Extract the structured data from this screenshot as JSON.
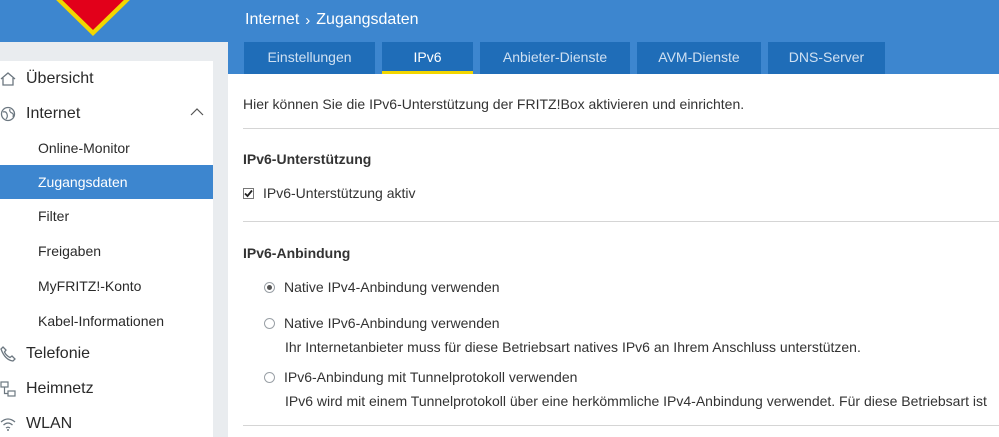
{
  "header": {
    "breadcrumb": [
      "Internet",
      "Zugangsdaten"
    ],
    "tabs": [
      "Einstellungen",
      "IPv6",
      "Anbieter-Dienste",
      "AVM-Dienste",
      "DNS-Server"
    ],
    "active_tab": "IPv6"
  },
  "sidebar": {
    "items": [
      {
        "label": "Übersicht",
        "icon": "home-icon"
      },
      {
        "label": "Internet",
        "icon": "globe-icon",
        "expanded": true
      },
      {
        "label": "Online-Monitor"
      },
      {
        "label": "Zugangsdaten",
        "active": true
      },
      {
        "label": "Filter"
      },
      {
        "label": "Freigaben"
      },
      {
        "label": "MyFRITZ!-Konto"
      },
      {
        "label": "Kabel-Informationen"
      },
      {
        "label": "Telefonie",
        "icon": "phone-icon"
      },
      {
        "label": "Heimnetz",
        "icon": "network-icon"
      },
      {
        "label": "WLAN",
        "icon": "wifi-icon"
      }
    ]
  },
  "main": {
    "intro": "Hier können Sie die IPv6-Unterstützung der FRITZ!Box aktivieren und einrichten.",
    "support": {
      "title": "IPv6-Unterstützung",
      "checkbox_label": "IPv6-Unterstützung aktiv",
      "checked": true
    },
    "connection": {
      "title": "IPv6-Anbindung",
      "options": [
        {
          "label": "Native IPv4-Anbindung verwenden",
          "selected": true,
          "hint": ""
        },
        {
          "label": "Native IPv6-Anbindung verwenden",
          "selected": false,
          "hint": "Ihr Internetanbieter muss für diese Betriebsart natives IPv6 an Ihrem Anschluss unterstützen."
        },
        {
          "label": "IPv6-Anbindung mit Tunnelprotokoll verwenden",
          "selected": false,
          "hint": "IPv6 wird mit einem Tunnelprotokoll über eine herkömmliche IPv4-Anbindung verwendet. Für diese Betriebsart ist"
        }
      ]
    }
  },
  "colors": {
    "brand_blue": "#3d86cf",
    "tab_dark": "#1f6db8",
    "tab_active_underline": "#f2d600"
  }
}
